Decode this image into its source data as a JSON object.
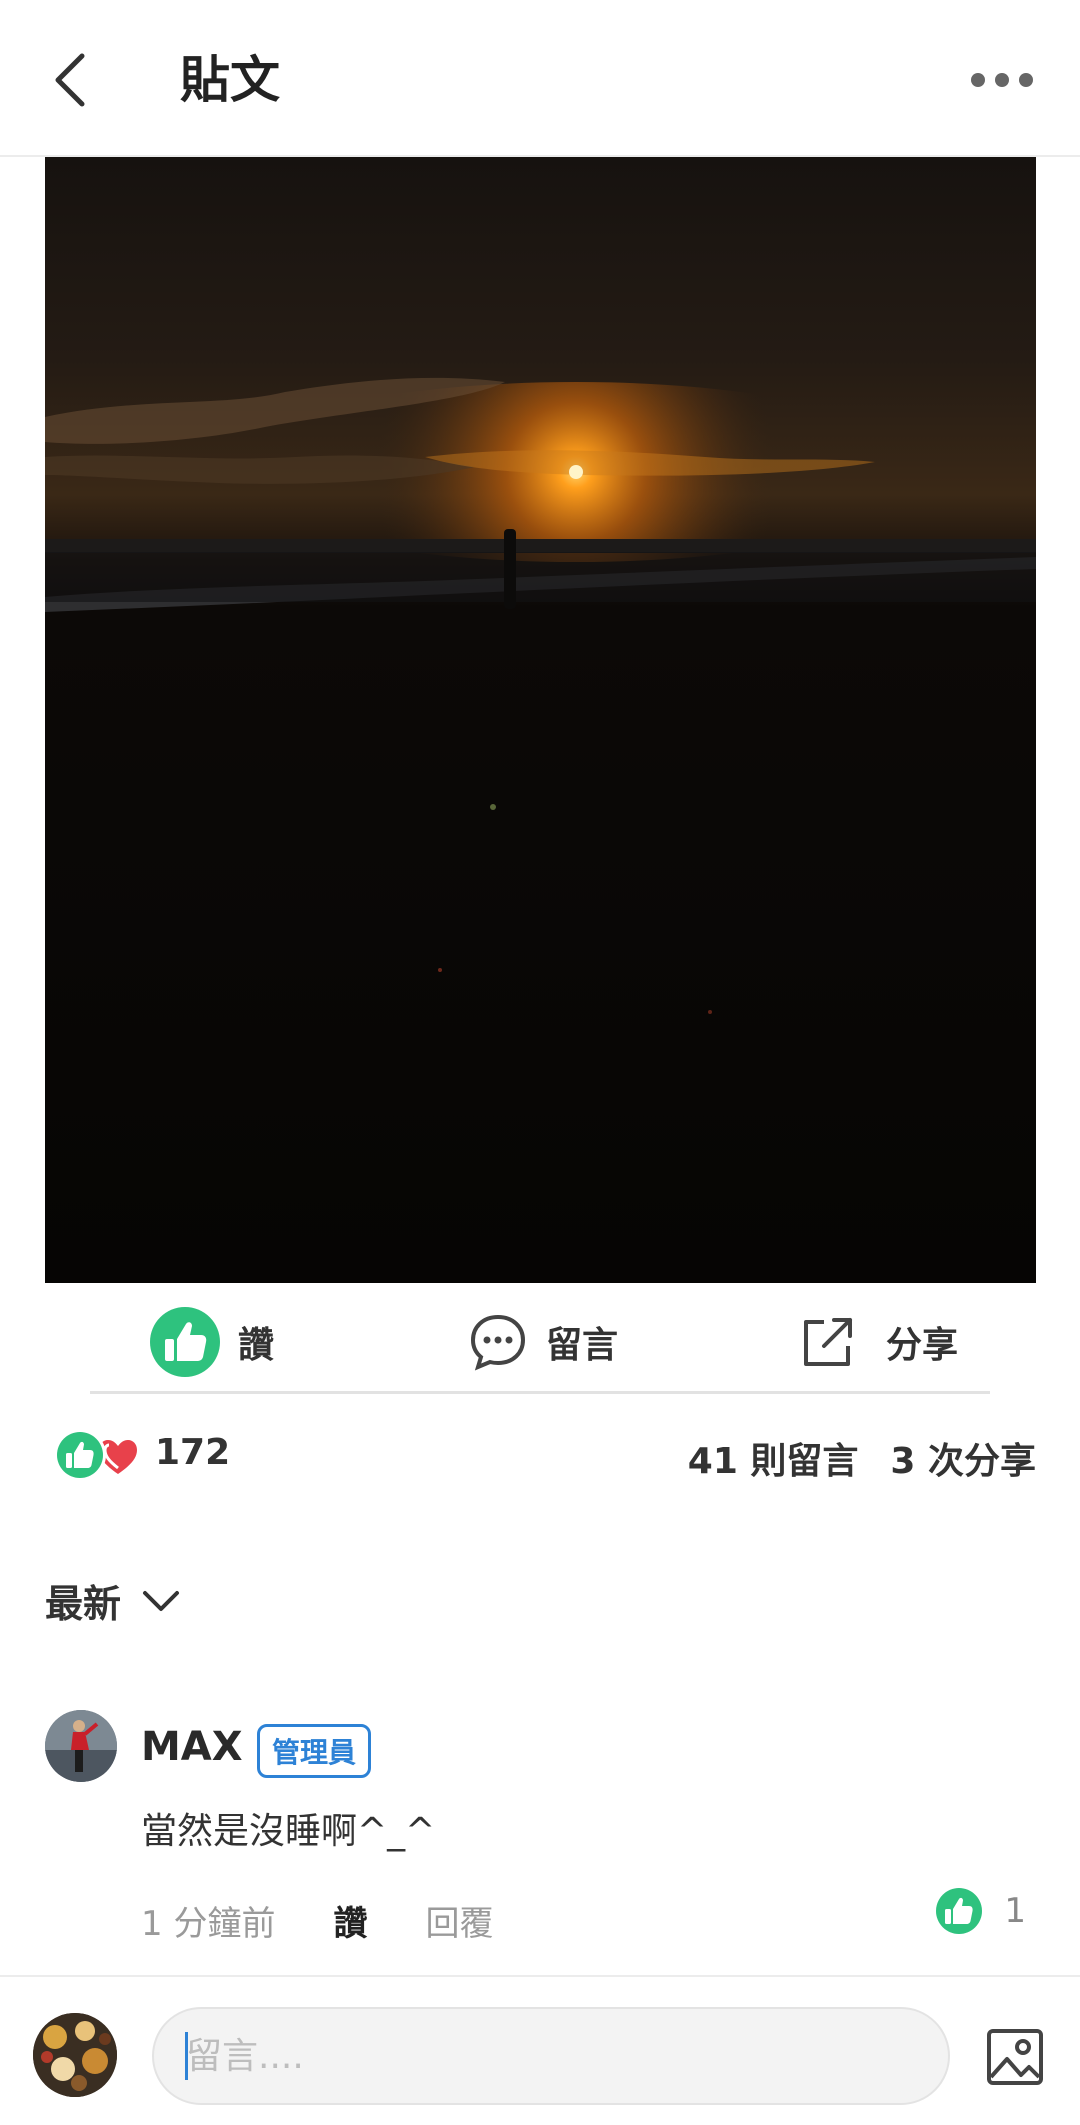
{
  "header": {
    "title": "貼文"
  },
  "actions": {
    "like_label": "讚",
    "comment_label": "留言",
    "share_label": "分享"
  },
  "stats": {
    "like_count": "172",
    "comments": "41 則留言",
    "shares": "3 次分享"
  },
  "sort": {
    "label": "最新"
  },
  "comment": {
    "author": "MAX",
    "badge": "管理員",
    "text": "當然是沒睡啊^_^",
    "time": "1 分鐘前",
    "like_label": "讚",
    "reply_label": "回覆",
    "like_count": "1"
  },
  "composer": {
    "placeholder": "留言...."
  },
  "colors": {
    "accent_green": "#2ec27e",
    "accent_blue": "#2d82d6",
    "heart_red": "#e8414b"
  }
}
